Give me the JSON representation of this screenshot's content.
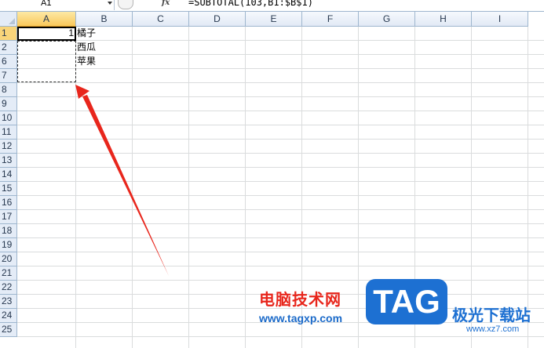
{
  "formula_bar": {
    "name_box": "A1",
    "fx_symbol": "fx",
    "formula": "=SUBTOTAL(103,B1:$B$1)"
  },
  "columns": [
    "A",
    "B",
    "C",
    "D",
    "E",
    "F",
    "G",
    "H",
    "I"
  ],
  "rows": [
    "1",
    "2",
    "6",
    "7",
    "8",
    "9",
    "10",
    "11",
    "12",
    "13",
    "14",
    "15",
    "16",
    "17",
    "18",
    "19",
    "20",
    "21",
    "22",
    "23",
    "24",
    "25"
  ],
  "cells": {
    "a1": "1",
    "b1": "橘子",
    "b2": "西瓜",
    "b6": "苹果"
  },
  "colors": {
    "annotation_arrow": "#e8261c",
    "selected_header": "#f9c85b",
    "header_bg": "#e4ecf7",
    "gridline": "#dadcdd"
  },
  "watermark": {
    "site_name": "电脑技术网",
    "site_url": "www.tagxp.com",
    "logo_text": "TAG",
    "brand_name": "极光下载站",
    "brand_url": "www.xz7.com"
  }
}
